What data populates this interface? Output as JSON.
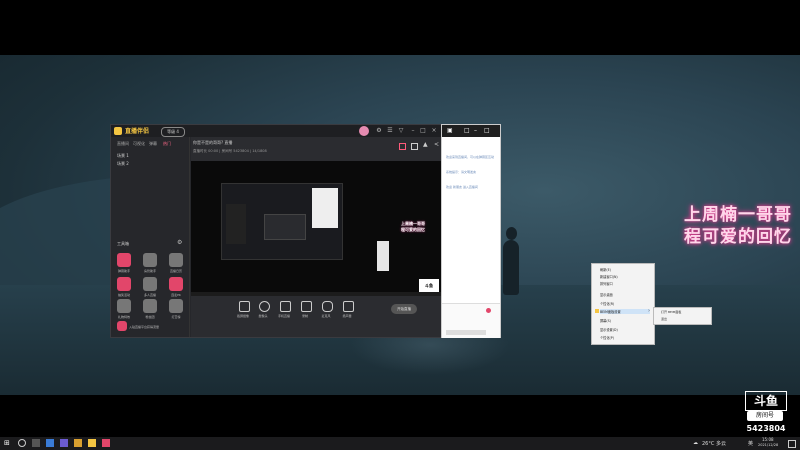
{
  "stream_overlay": {
    "line1": "上周楠一哥哥",
    "line2": "程可爱的回忆"
  },
  "app": {
    "name": "直播伴侣",
    "level_badge": "等级 4",
    "tabs": [
      "直播间",
      "可视化",
      "弹幕",
      "热门"
    ],
    "active_tab": 3,
    "scenes": [
      "场景 1",
      "场景 2"
    ],
    "tools_title": "工具箱",
    "tools": [
      {
        "label": "弹幕助手",
        "color": "#e2466a"
      },
      {
        "label": "房管助手",
        "color": "#8a8a8a"
      },
      {
        "label": "直播日历",
        "color": "#8a8a8a"
      },
      {
        "label": "抽奖活动",
        "color": "#e2466a"
      },
      {
        "label": "多人直播",
        "color": "#8a8a8a"
      },
      {
        "label": "连麦PK",
        "color": "#e2466a"
      },
      {
        "label": "礼物特效",
        "color": "#8a8a8a"
      },
      {
        "label": "粉丝团",
        "color": "#8a8a8a"
      },
      {
        "label": "打赏榜",
        "color": "#8a8a8a"
      },
      {
        "label": "入驻直播平台获得流量",
        "color": "#e2466a"
      }
    ],
    "stream_title": "你是不是的哥哥? 直播",
    "stream_meta": "直播时长 00:00  |  房间号 5423804  |  14/1808",
    "bottom_tools": [
      "截屏摄像",
      "摄像头",
      "手机直播",
      "录制",
      "麦克风",
      "扬声器"
    ],
    "start_button": "开始直播",
    "window_controls": [
      "设置",
      "菜单",
      "最小化",
      "最大化",
      "关闭"
    ]
  },
  "nested": {
    "text1": "上周楠一哥哥",
    "text2": "程可爱的回忆"
  },
  "chat": {
    "lines": [
      "欢迎来到直播间，可以在弹幕区互动",
      "系统提示：请文明发言",
      "欢迎 新朋友 进入直播间"
    ]
  },
  "context_menu": {
    "items": [
      "刷新(E)",
      "新建窗口(N)",
      "排列窗口",
      "显示桌面",
      "个性化(R)",
      "BEIM面板设置",
      "屏幕(S)",
      "显示设置(D)",
      "个性化(P)"
    ],
    "highlighted": 5,
    "submenu": [
      "打开 BEIM面板",
      "退出"
    ]
  },
  "watermark": {
    "logo": "斗鱼",
    "room_label": "房间号",
    "room_number": "5423804"
  },
  "taskbar": {
    "weather": "26°C 多云",
    "lang": "英",
    "time": "15:08",
    "date": "2021/12/28"
  }
}
